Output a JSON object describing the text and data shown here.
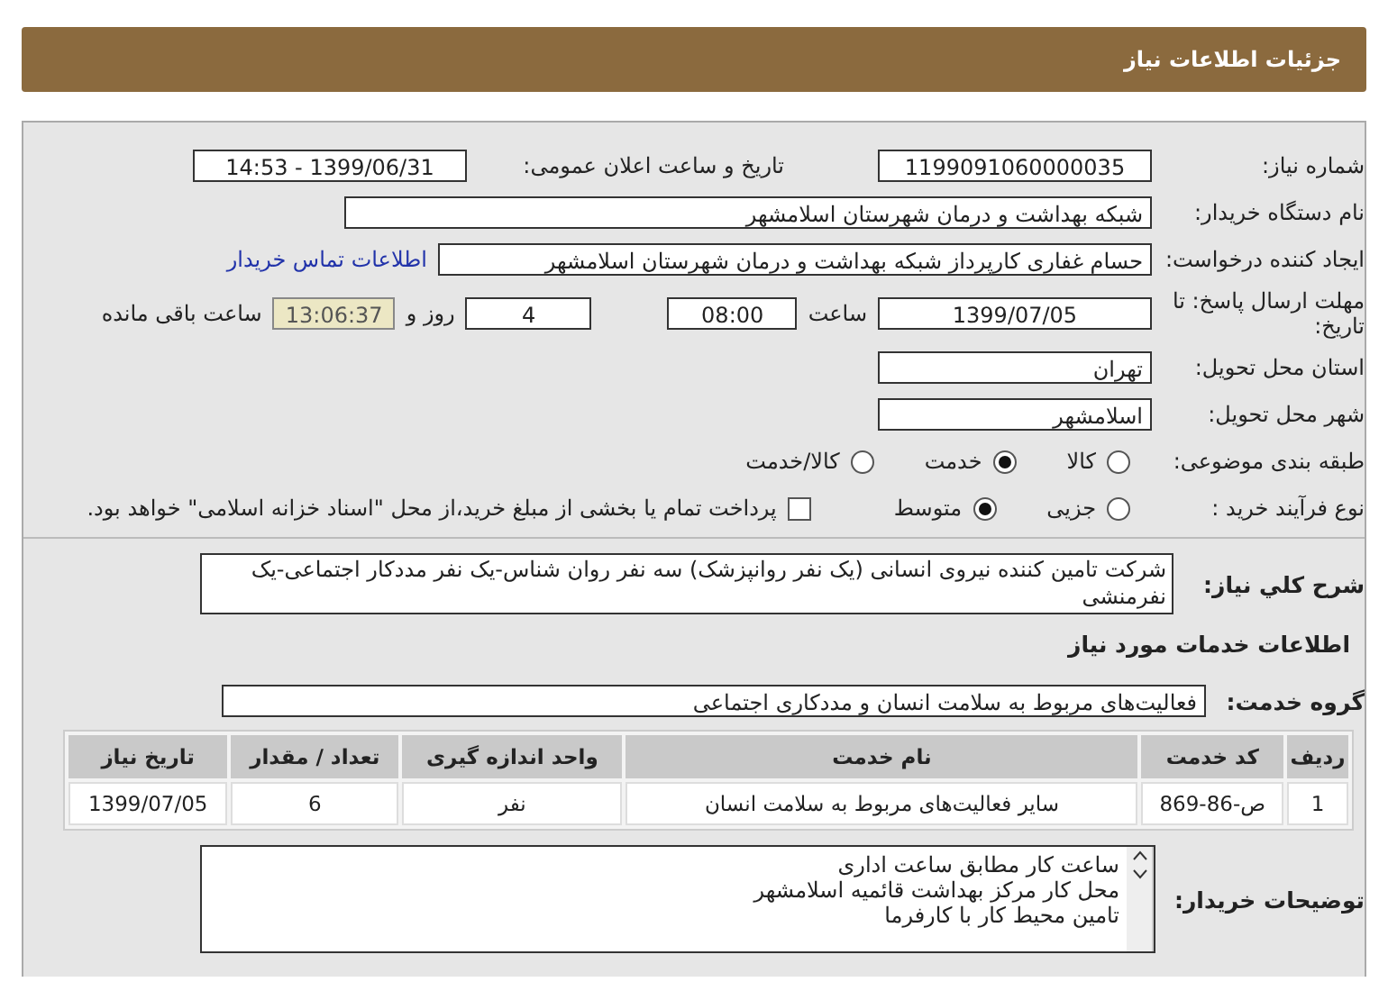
{
  "header": {
    "title": "جزئیات اطلاعات نیاز"
  },
  "fields": {
    "need_number": {
      "label": "شماره نیاز:",
      "value": "1199091060000035"
    },
    "announce": {
      "label": "تاریخ و ساعت اعلان عمومی:",
      "value": "1399/06/31 - 14:53"
    },
    "buyer": {
      "label": "نام دستگاه خریدار:",
      "value": "شبکه بهداشت و درمان شهرستان اسلامشهر"
    },
    "creator": {
      "label": "ایجاد کننده درخواست:",
      "value": "حسام غفاری کارپرداز شبکه بهداشت و درمان شهرستان اسلامشهر",
      "link": "اطلاعات تماس خریدار"
    },
    "deadline": {
      "label": "مهلت ارسال پاسخ: تا تاریخ:",
      "date": "1399/07/05",
      "time_label": "ساعت",
      "time": "08:00",
      "days": "4",
      "days_label": "روز و",
      "remaining": "13:06:37",
      "remaining_label": "ساعت باقی مانده"
    },
    "province": {
      "label": "استان محل تحویل:",
      "value": "تهران"
    },
    "city": {
      "label": "شهر محل تحویل:",
      "value": "اسلامشهر"
    },
    "category": {
      "label": "طبقه بندی موضوعی:",
      "options": [
        {
          "label": "کالا",
          "selected": false
        },
        {
          "label": "خدمت",
          "selected": true
        },
        {
          "label": "کالا/خدمت",
          "selected": false
        }
      ]
    },
    "process": {
      "label": "نوع فرآیند خرید :",
      "options": [
        {
          "label": "جزیی",
          "selected": false
        },
        {
          "label": "متوسط",
          "selected": true
        }
      ],
      "payment": {
        "label": "پرداخت تمام یا بخشی از مبلغ خرید،از محل \"اسناد خزانه اسلامی\" خواهد بود.",
        "checked": false
      }
    }
  },
  "description": {
    "label": "شرح کلي نياز:",
    "value": "شرکت تامین کننده نیروی انسانی (یک نفر روانپزشک) سه نفر روان شناس-یک نفر مددکار اجتماعی-یک نفرمنشی"
  },
  "services": {
    "heading": "اطلاعات خدمات مورد نیاز",
    "group_label": "گروه خدمت:",
    "group": "فعالیت‌های مربوط به سلامت انسان و مددکاری اجتماعی",
    "table": {
      "columns": [
        "ردیف",
        "کد خدمت",
        "نام خدمت",
        "واحد اندازه گیری",
        "تعداد / مقدار",
        "تاریخ نیاز"
      ],
      "rows": [
        [
          "1",
          "ص-86-869",
          "سایر فعالیت‌های مربوط به سلامت انسان",
          "نفر",
          "6",
          "1399/07/05"
        ]
      ]
    }
  },
  "buyer_notes": {
    "label": "توضیحات خریدار:",
    "lines": [
      "ساعت کار مطابق ساعت اداری",
      "محل کار مرکز بهداشت قائمیه اسلامشهر",
      "تامین محیط کار با کارفرما"
    ]
  }
}
